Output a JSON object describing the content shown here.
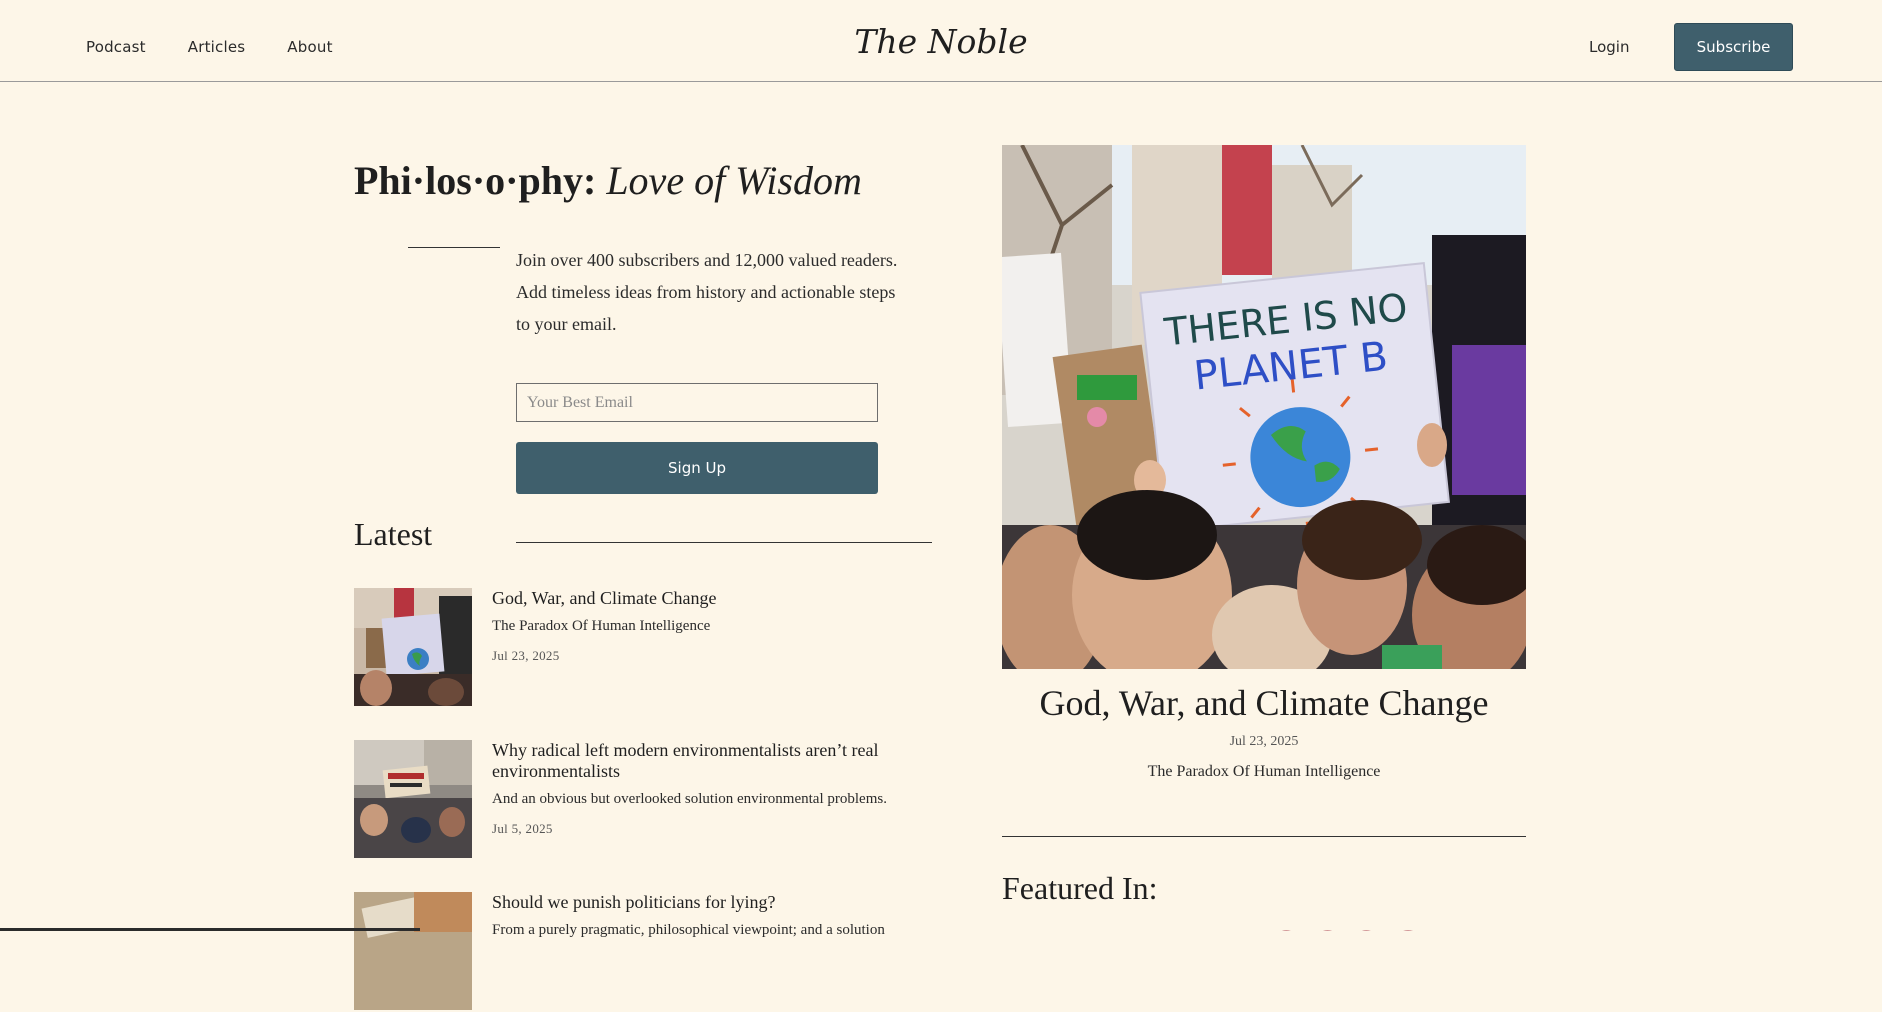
{
  "header": {
    "nav": [
      "Podcast",
      "Articles",
      "About"
    ],
    "brand": "The Noble",
    "login_label": "Login",
    "subscribe_label": "Subscribe"
  },
  "hero": {
    "title_main": "Phi·los·o·phy:",
    "title_italic": "Love of Wisdom",
    "intro": "Join over 400 subscribers and 12,000 valued readers. Add timeless ideas from history and actionable steps to your email.",
    "email_placeholder": "Your Best Email",
    "signup_label": "Sign Up"
  },
  "latest": {
    "heading": "Latest",
    "articles": [
      {
        "title": "God, War, and Climate Change",
        "subtitle": "The Paradox Of Human Intelligence",
        "date": "Jul 23, 2025"
      },
      {
        "title": "Why radical left modern environmentalists aren’t real environmentalists",
        "subtitle": "And an obvious but overlooked solution environmental problems.",
        "date": "Jul 5, 2025"
      },
      {
        "title": "Should we punish politicians for lying?",
        "subtitle": "From a purely pragmatic, philosophical viewpoint; and a solution",
        "date": ""
      }
    ]
  },
  "featured": {
    "title": "God, War, and Climate Change",
    "date": "Jul 23, 2025",
    "subtitle": "The Paradox Of Human Intelligence",
    "sign_text_1": "THERE IS NO",
    "sign_text_2": "PLANET B",
    "featured_in_label": "Featured In:"
  },
  "colors": {
    "background": "#fdf6e8",
    "accent": "#3f5f6c",
    "text": "#1f1f1f"
  }
}
